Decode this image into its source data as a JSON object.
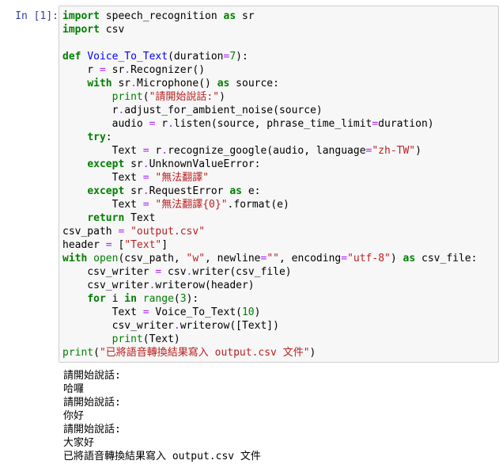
{
  "cell": {
    "prompt": "In [1]:",
    "code_lines": [
      [
        {
          "t": "import",
          "c": "kw"
        },
        {
          "t": " speech_recognition "
        },
        {
          "t": "as",
          "c": "kw"
        },
        {
          "t": " sr"
        }
      ],
      [
        {
          "t": "import",
          "c": "kw"
        },
        {
          "t": " csv"
        }
      ],
      [],
      [
        {
          "t": "def",
          "c": "kw"
        },
        {
          "t": " "
        },
        {
          "t": "Voice_To_Text",
          "c": "fn"
        },
        {
          "t": "(duration"
        },
        {
          "t": "=",
          "c": "op"
        },
        {
          "t": "7",
          "c": "num"
        },
        {
          "t": "):"
        }
      ],
      [
        {
          "t": "    r "
        },
        {
          "t": "=",
          "c": "op"
        },
        {
          "t": " sr"
        },
        {
          "t": ".",
          "c": "op"
        },
        {
          "t": "Recognizer()"
        }
      ],
      [
        {
          "t": "    "
        },
        {
          "t": "with",
          "c": "kw"
        },
        {
          "t": " sr"
        },
        {
          "t": ".",
          "c": "op"
        },
        {
          "t": "Microphone() "
        },
        {
          "t": "as",
          "c": "kw"
        },
        {
          "t": " source:"
        }
      ],
      [
        {
          "t": "        "
        },
        {
          "t": "print",
          "c": "num"
        },
        {
          "t": "("
        },
        {
          "t": "\"請開始說話:\"",
          "c": "str"
        },
        {
          "t": ")"
        }
      ],
      [
        {
          "t": "        r"
        },
        {
          "t": ".",
          "c": "op"
        },
        {
          "t": "adjust_for_ambient_noise(source)"
        }
      ],
      [
        {
          "t": "        audio "
        },
        {
          "t": "=",
          "c": "op"
        },
        {
          "t": " r"
        },
        {
          "t": ".",
          "c": "op"
        },
        {
          "t": "listen(source, phrase_time_limit"
        },
        {
          "t": "=",
          "c": "op"
        },
        {
          "t": "duration)"
        }
      ],
      [
        {
          "t": "    "
        },
        {
          "t": "try",
          "c": "kw"
        },
        {
          "t": ":"
        }
      ],
      [
        {
          "t": "        Text "
        },
        {
          "t": "=",
          "c": "op"
        },
        {
          "t": " r"
        },
        {
          "t": ".",
          "c": "op"
        },
        {
          "t": "recognize_google(audio, language"
        },
        {
          "t": "=",
          "c": "op"
        },
        {
          "t": "\"zh-TW\"",
          "c": "str"
        },
        {
          "t": ")"
        }
      ],
      [
        {
          "t": "    "
        },
        {
          "t": "except",
          "c": "kw"
        },
        {
          "t": " sr"
        },
        {
          "t": ".",
          "c": "op"
        },
        {
          "t": "UnknownValueError:"
        }
      ],
      [
        {
          "t": "        Text "
        },
        {
          "t": "=",
          "c": "op"
        },
        {
          "t": " "
        },
        {
          "t": "\"無法翻譯\"",
          "c": "str"
        }
      ],
      [
        {
          "t": "    "
        },
        {
          "t": "except",
          "c": "kw"
        },
        {
          "t": " sr"
        },
        {
          "t": ".",
          "c": "op"
        },
        {
          "t": "RequestError "
        },
        {
          "t": "as",
          "c": "kw"
        },
        {
          "t": " e:"
        }
      ],
      [
        {
          "t": "        Text "
        },
        {
          "t": "=",
          "c": "op"
        },
        {
          "t": " "
        },
        {
          "t": "\"無法翻譯{0}\"",
          "c": "str"
        },
        {
          "t": "."
        },
        {
          "t": "format(e)"
        }
      ],
      [
        {
          "t": "    "
        },
        {
          "t": "return",
          "c": "kw"
        },
        {
          "t": " Text"
        }
      ],
      [
        {
          "t": "csv_path "
        },
        {
          "t": "=",
          "c": "op"
        },
        {
          "t": " "
        },
        {
          "t": "\"output.csv\"",
          "c": "str"
        }
      ],
      [
        {
          "t": "header "
        },
        {
          "t": "=",
          "c": "op"
        },
        {
          "t": " ["
        },
        {
          "t": "\"Text\"",
          "c": "str"
        },
        {
          "t": "]"
        }
      ],
      [
        {
          "t": "with",
          "c": "kw"
        },
        {
          "t": " "
        },
        {
          "t": "open",
          "c": "num"
        },
        {
          "t": "(csv_path, "
        },
        {
          "t": "\"w\"",
          "c": "str"
        },
        {
          "t": ", newline"
        },
        {
          "t": "=",
          "c": "op"
        },
        {
          "t": "\"\"",
          "c": "str"
        },
        {
          "t": ", encoding"
        },
        {
          "t": "=",
          "c": "op"
        },
        {
          "t": "\"utf-8\"",
          "c": "str"
        },
        {
          "t": ") "
        },
        {
          "t": "as",
          "c": "kw"
        },
        {
          "t": " csv_file:"
        }
      ],
      [
        {
          "t": "    csv_writer "
        },
        {
          "t": "=",
          "c": "op"
        },
        {
          "t": " csv"
        },
        {
          "t": ".",
          "c": "op"
        },
        {
          "t": "writer(csv_file)"
        }
      ],
      [
        {
          "t": "    csv_writer"
        },
        {
          "t": ".",
          "c": "op"
        },
        {
          "t": "writerow(header)"
        }
      ],
      [
        {
          "t": "    "
        },
        {
          "t": "for",
          "c": "kw"
        },
        {
          "t": " i "
        },
        {
          "t": "in",
          "c": "kw"
        },
        {
          "t": " "
        },
        {
          "t": "range",
          "c": "num"
        },
        {
          "t": "("
        },
        {
          "t": "3",
          "c": "num"
        },
        {
          "t": "):"
        }
      ],
      [
        {
          "t": "        Text "
        },
        {
          "t": "=",
          "c": "op"
        },
        {
          "t": " Voice_To_Text("
        },
        {
          "t": "10",
          "c": "num"
        },
        {
          "t": ")"
        }
      ],
      [
        {
          "t": "        csv_writer"
        },
        {
          "t": ".",
          "c": "op"
        },
        {
          "t": "writerow([Text])"
        }
      ],
      [
        {
          "t": "        "
        },
        {
          "t": "print",
          "c": "num"
        },
        {
          "t": "(Text)"
        }
      ],
      [
        {
          "t": "print",
          "c": "num"
        },
        {
          "t": "("
        },
        {
          "t": "\"已將語音轉換結果寫入 output.csv 文件\"",
          "c": "str"
        },
        {
          "t": ")"
        }
      ]
    ],
    "output_lines": [
      "請開始說話:",
      "哈囉",
      "請開始說話:",
      "你好",
      "請開始說話:",
      "大家好",
      "已將語音轉換結果寫入 output.csv 文件"
    ]
  },
  "colors": {
    "prompt": "#303f9f",
    "keyword": "#008000",
    "function_name": "#0000ff",
    "string": "#ba2121",
    "operator": "#aa22ff",
    "cell_background": "#f7f7f7",
    "cell_border": "#cfcfcf"
  }
}
